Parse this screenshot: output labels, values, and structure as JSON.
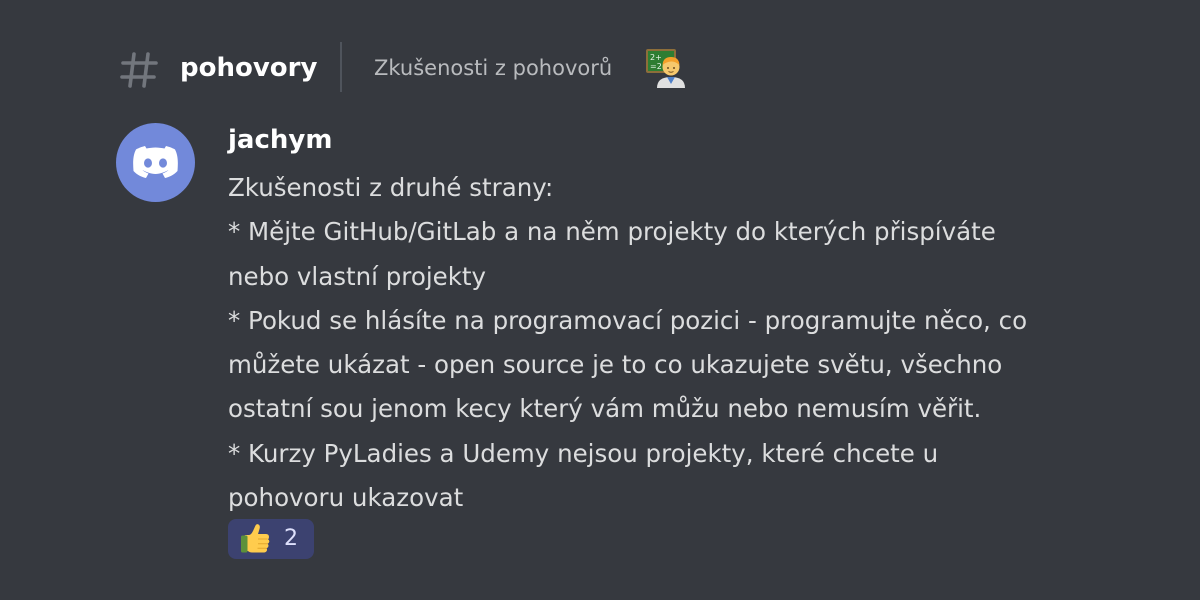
{
  "header": {
    "channel_icon": "hash-icon",
    "channel_name": "pohovory",
    "topic": "Zkušenosti z pohovorů",
    "topic_emoji": "teacher-emoji-icon"
  },
  "message": {
    "author": "jachym",
    "avatar_icon": "discord-logo-icon",
    "avatar_color": "#7289da",
    "lines": [
      "Zkušenosti z druhé strany:",
      "* Mějte GitHub/GitLab a na něm projekty do kterých přispíváte",
      "nebo vlastní projekty",
      "* Pokud se hlásíte na programovací pozici - programujte něco, co",
      "můžete ukázat - open source je to co ukazujete světu, všechno",
      "ostatní sou jenom kecy který vám můžu nebo nemusím věřit.",
      "* Kurzy PyLadies a Udemy nejsou projekty, které chcete u",
      "pohovoru ukazovat"
    ]
  },
  "reaction": {
    "emoji": "thumbs-up-icon",
    "count": "2",
    "background": "#3c4270"
  },
  "colors": {
    "background": "#36393f",
    "text": "#dcddde",
    "muted": "#b9bbbe",
    "accent": "#7289da"
  }
}
